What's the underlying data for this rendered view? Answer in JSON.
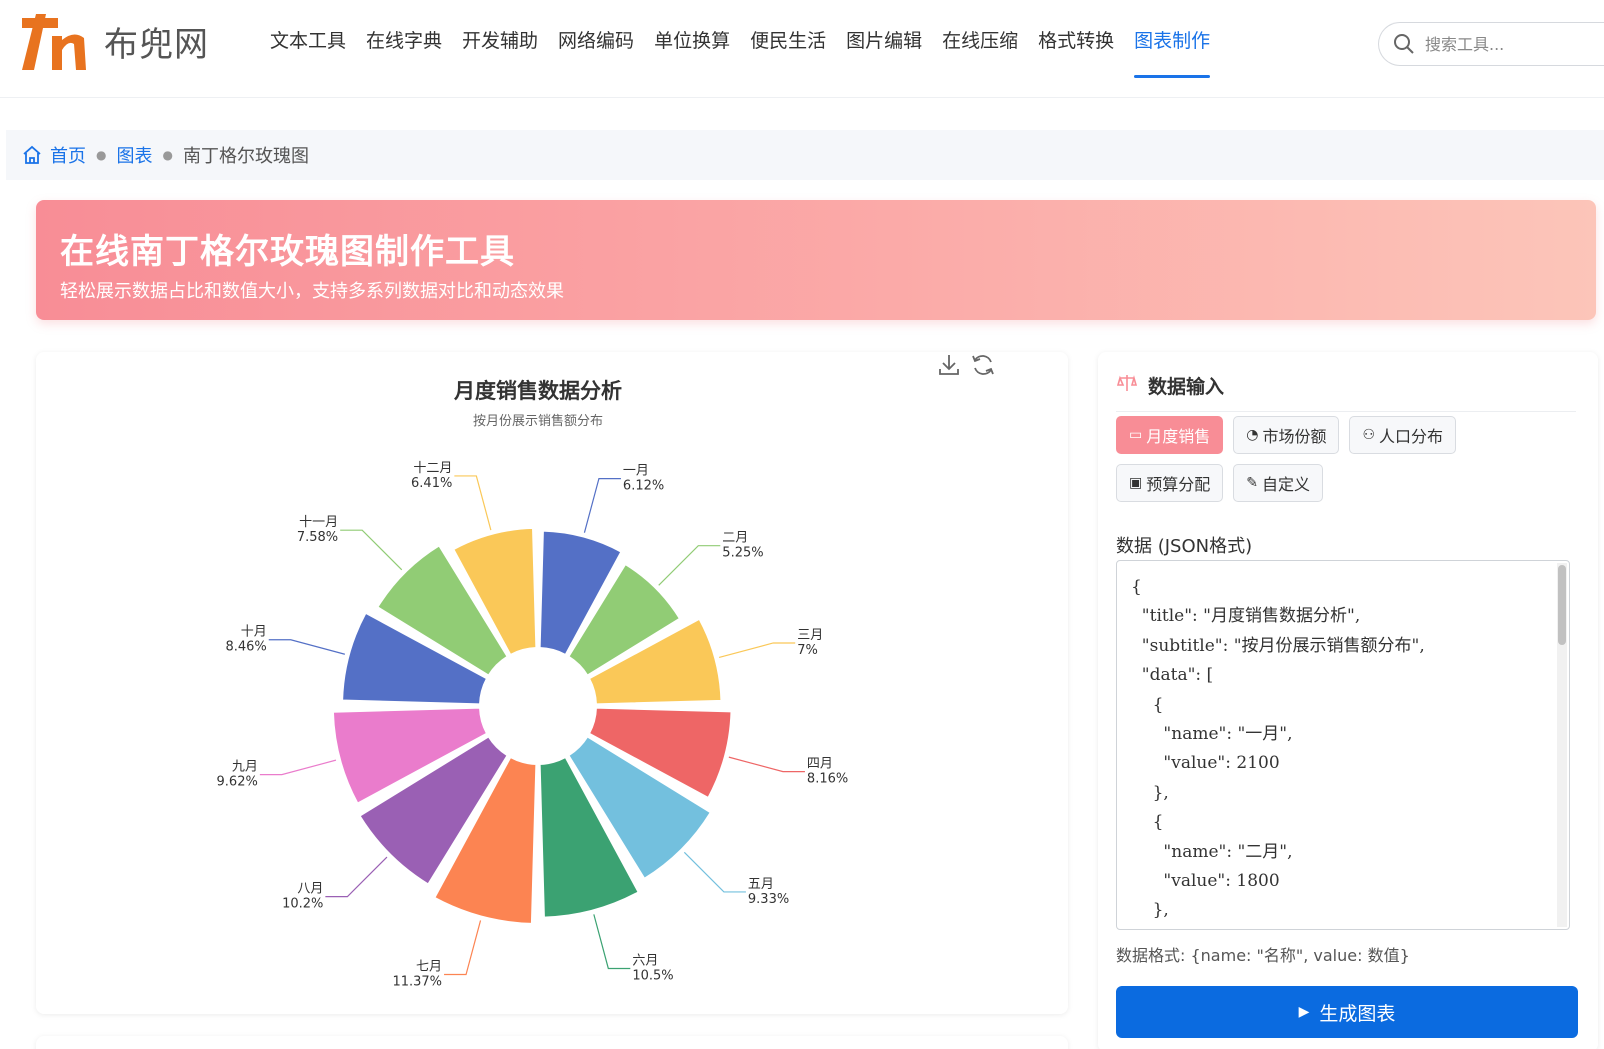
{
  "header": {
    "logo_text": "布兜网",
    "nav": [
      "文本工具",
      "在线字典",
      "开发辅助",
      "网络编码",
      "单位换算",
      "便民生活",
      "图片编辑",
      "在线压缩",
      "格式转换",
      "图表制作"
    ],
    "active_nav": "图表制作",
    "search_placeholder": "搜索工具..."
  },
  "breadcrumb": {
    "home": "首页",
    "category": "图表",
    "current": "南丁格尔玫瑰图"
  },
  "banner": {
    "title": "在线南丁格尔玫瑰图制作工具",
    "subtitle": "轻松展示数据占比和数值大小，支持多系列数据对比和动态效果"
  },
  "chart_data": {
    "type": "pie",
    "variant": "nightingale-rose",
    "title": "月度销售数据分析",
    "subtitle": "按月份展示销售额分布",
    "categories": [
      "一月",
      "二月",
      "三月",
      "四月",
      "五月",
      "六月",
      "七月",
      "八月",
      "九月",
      "十月",
      "十一月",
      "十二月"
    ],
    "values": [
      2100,
      1800,
      2400,
      2800,
      3200,
      3600,
      3900,
      3500,
      3300,
      2900,
      2600,
      2200
    ],
    "percent_labels": [
      "6.12%",
      "5.25%",
      "7%",
      "8.16%",
      "9.33%",
      "10.5%",
      "11.37%",
      "10.2%",
      "9.62%",
      "8.46%",
      "7.58%",
      "6.41%"
    ],
    "colors": [
      "#5470c6",
      "#91cc75",
      "#fac858",
      "#ee6666",
      "#73c0de",
      "#3ba272",
      "#fc8452",
      "#9a60b4",
      "#ea7ccc",
      "#5470c6",
      "#91cc75",
      "#fac858"
    ],
    "legend": "none"
  },
  "chart_toolbar": {
    "icons": [
      "download-icon",
      "refresh-icon"
    ]
  },
  "panel": {
    "title": "数据输入",
    "templates": [
      {
        "label": "月度销售",
        "icon": "calendar-icon",
        "active": true
      },
      {
        "label": "市场份额",
        "icon": "pie-icon",
        "active": false
      },
      {
        "label": "人口分布",
        "icon": "users-icon",
        "active": false
      },
      {
        "label": "预算分配",
        "icon": "money-icon",
        "active": false
      },
      {
        "label": "自定义",
        "icon": "edit-icon",
        "active": false
      }
    ],
    "data_label": "数据 (JSON格式)",
    "json_text": "{\n  \"title\": \"月度销售数据分析\",\n  \"subtitle\": \"按月份展示销售额分布\",\n  \"data\": [\n    {\n      \"name\": \"一月\",\n      \"value\": 2100\n    },\n    {\n      \"name\": \"二月\",\n      \"value\": 1800\n    },",
    "format_hint": "数据格式: {name: \"名称\", value: 数值}",
    "generate_label": "生成图表"
  }
}
